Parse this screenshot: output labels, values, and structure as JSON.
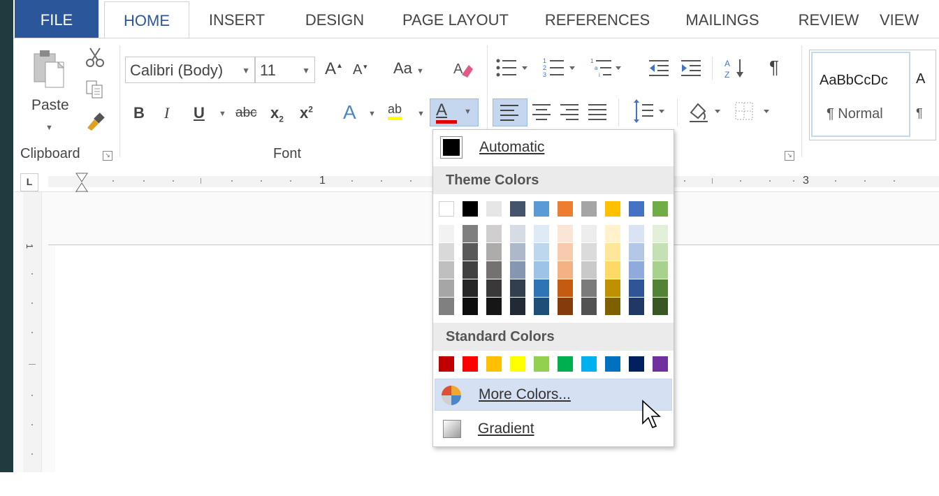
{
  "tabs": [
    {
      "label": "FILE"
    },
    {
      "label": "HOME"
    },
    {
      "label": "INSERT"
    },
    {
      "label": "DESIGN"
    },
    {
      "label": "PAGE LAYOUT"
    },
    {
      "label": "REFERENCES"
    },
    {
      "label": "MAILINGS"
    },
    {
      "label": "REVIEW"
    },
    {
      "label": "VIEW"
    }
  ],
  "clipboard": {
    "paste_label": "Paste",
    "group_label": "Clipboard"
  },
  "font": {
    "font_name": "Calibri (Body)",
    "font_size": "11",
    "group_label": "Font",
    "grow_label": "A",
    "shrink_label": "A",
    "case_label": "Aa",
    "bold": "B",
    "italic": "I",
    "underline": "U",
    "strike": "abc",
    "sub": "x",
    "sub_mark": "2",
    "sup": "x",
    "sup_mark": "2",
    "text_effects": "A",
    "highlight": "ab",
    "font_color": "A"
  },
  "styles": {
    "preview": "AaBbCcDc",
    "name": "¶ Normal",
    "next_preview": "A",
    "next_name": "¶"
  },
  "ruler": {
    "n1": "1",
    "n3": "3",
    "v1": "1"
  },
  "color_menu": {
    "automatic_label": "Automatic",
    "automatic_color": "#000000",
    "theme_header": "Theme Colors",
    "theme_top": [
      "#ffffff",
      "#000000",
      "#e7e6e6",
      "#44546a",
      "#5b9bd5",
      "#ed7d31",
      "#a5a5a5",
      "#ffc000",
      "#4472c4",
      "#70ad47"
    ],
    "theme_shades": [
      [
        "#f2f2f2",
        "#d9d9d9",
        "#bfbfbf",
        "#a6a6a6",
        "#808080"
      ],
      [
        "#7f7f7f",
        "#595959",
        "#404040",
        "#262626",
        "#0d0d0d"
      ],
      [
        "#d0cece",
        "#aeabab",
        "#757171",
        "#3a3838",
        "#171616"
      ],
      [
        "#d6dce4",
        "#adb9ca",
        "#8496b0",
        "#323f4f",
        "#222a35"
      ],
      [
        "#deebf7",
        "#bdd7ee",
        "#9dc3e6",
        "#2e75b6",
        "#1f4e79"
      ],
      [
        "#fbe5d6",
        "#f8cbad",
        "#f4b183",
        "#c55a11",
        "#843c0c"
      ],
      [
        "#ededed",
        "#dbdbdb",
        "#c9c9c9",
        "#7b7b7b",
        "#525252"
      ],
      [
        "#fff2cc",
        "#ffe699",
        "#ffd966",
        "#bf9000",
        "#7f6000"
      ],
      [
        "#dae3f3",
        "#b4c7e7",
        "#8faadc",
        "#2f5597",
        "#1f3864"
      ],
      [
        "#e2f0d9",
        "#c5e0b4",
        "#a9d18e",
        "#548235",
        "#385723"
      ]
    ],
    "standard_header": "Standard Colors",
    "standard": [
      "#c00000",
      "#ff0000",
      "#ffc000",
      "#ffff00",
      "#92d050",
      "#00b050",
      "#00b0f0",
      "#0070c0",
      "#002060",
      "#7030a0"
    ],
    "more_colors_label": "More Colors...",
    "gradient_label": "Gradient"
  }
}
